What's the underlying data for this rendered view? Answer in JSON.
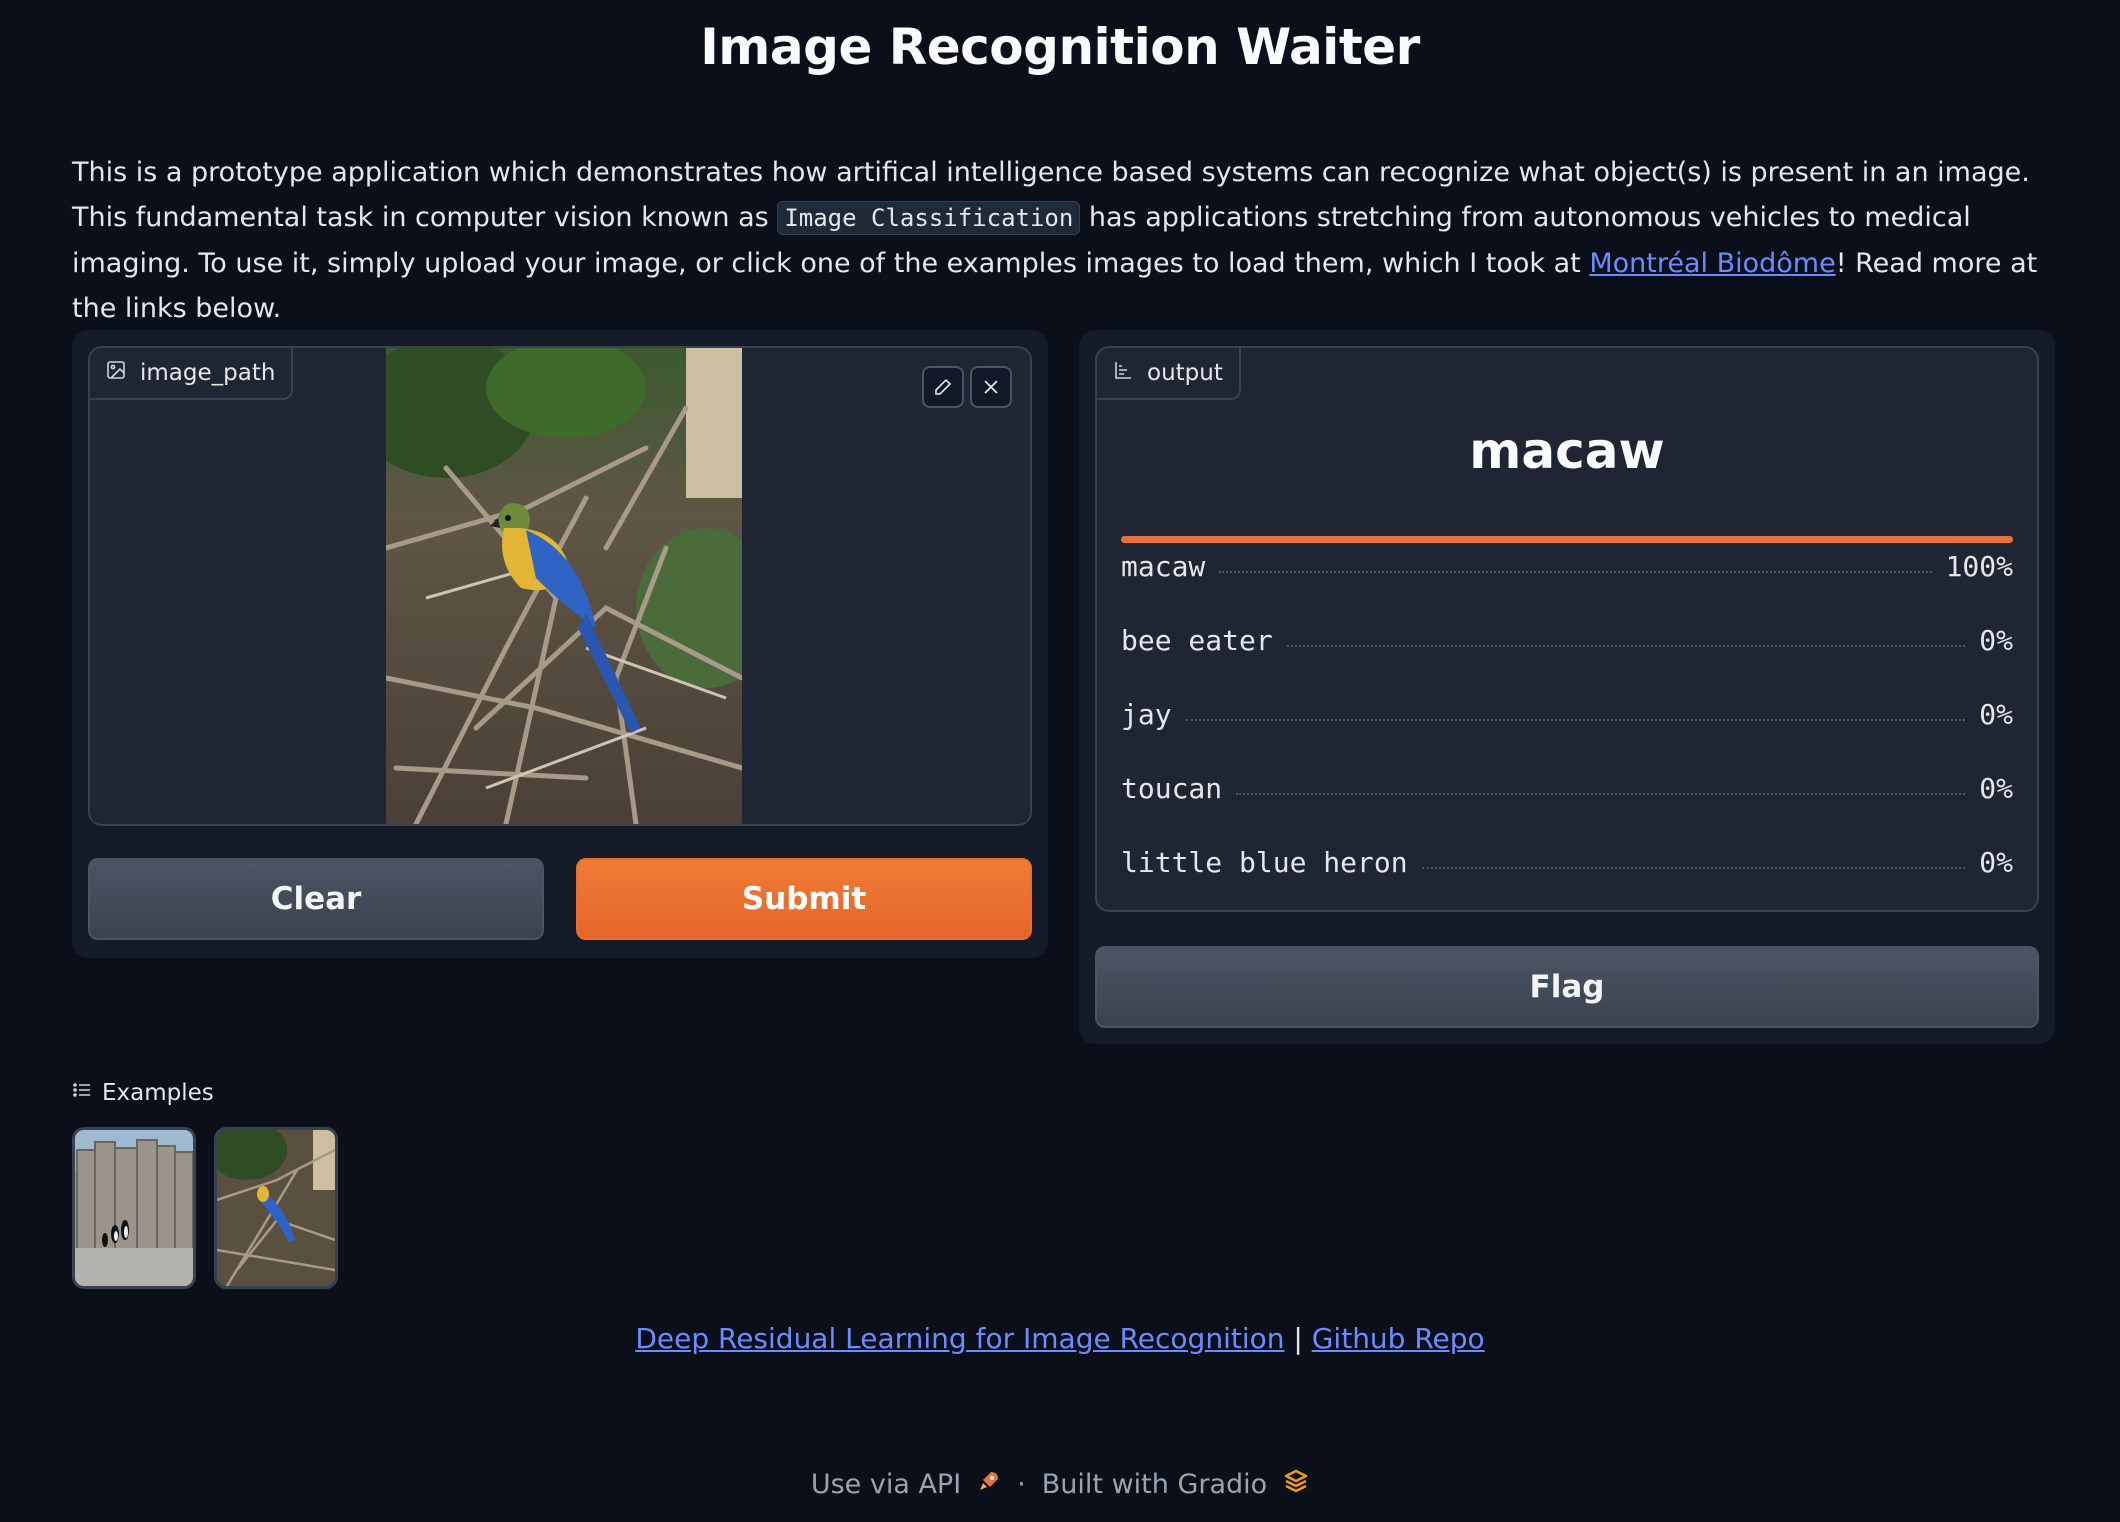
{
  "page": {
    "title": "Image Recognition Waiter",
    "description": {
      "part1": "This is a prototype application which demonstrates how artifical intelligence based systems can recognize what object(s) is present in an image. This fundamental task in computer vision known as ",
      "code": "Image Classification",
      "part2": " has applications stretching from autonomous vehicles to medical imaging. To use it, simply upload your image, or click one of the examples images to load them, which I took at ",
      "link": "Montréal Biodôme",
      "part3": "! Read more at the links below."
    }
  },
  "input": {
    "label": "image_path",
    "label_icon": "image-icon",
    "edit_icon": "pencil-icon",
    "clear_icon": "close-icon"
  },
  "buttons": {
    "clear": "Clear",
    "submit": "Submit",
    "flag": "Flag"
  },
  "output": {
    "label": "output",
    "label_icon": "bar-chart-icon",
    "top_label": "macaw",
    "top_confidence": 1.0,
    "confidences": [
      {
        "label": "macaw",
        "value": "100%"
      },
      {
        "label": "bee eater",
        "value": "0%"
      },
      {
        "label": "jay",
        "value": "0%"
      },
      {
        "label": "toucan",
        "value": "0%"
      },
      {
        "label": "little blue heron",
        "value": "0%"
      }
    ]
  },
  "examples": {
    "label": "Examples",
    "icon": "list-icon",
    "items": [
      "penguins-thumbnail",
      "macaw-thumbnail"
    ]
  },
  "links": {
    "paper": "Deep Residual Learning for Image Recognition",
    "separator": "|",
    "repo": "Github Repo"
  },
  "footer": {
    "api": "Use via API",
    "dot": "·",
    "built": "Built with Gradio"
  },
  "colors": {
    "background": "#0b0f19",
    "panel": "#151b28",
    "accent": "#e8733a",
    "link": "#6b8cff"
  }
}
